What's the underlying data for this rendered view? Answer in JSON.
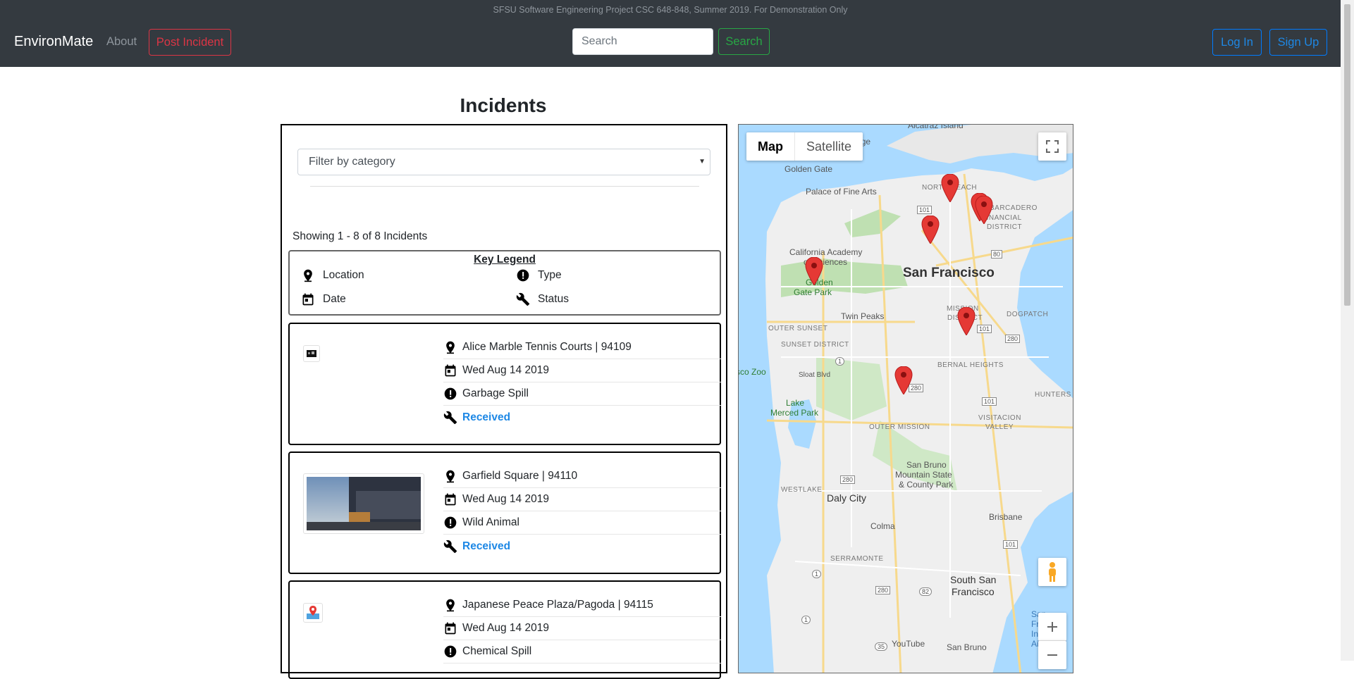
{
  "navbar": {
    "banner": "SFSU Software Engineering Project CSC 648-848, Summer 2019. For Demonstration Only",
    "brand": "EnvironMate",
    "about": "About",
    "post_incident": "Post Incident",
    "search_placeholder": "Search",
    "search_button": "Search",
    "login": "Log In",
    "signup": "Sign Up"
  },
  "page": {
    "title": "Incidents",
    "filter_placeholder": "Filter by category",
    "showing_text": "Showing 1 - 8 of 8 Incidents"
  },
  "legend": {
    "title": "Key Legend",
    "location": "Location",
    "type": "Type",
    "date": "Date",
    "status": "Status"
  },
  "incidents": [
    {
      "location": "Alice Marble Tennis Courts | 94109",
      "date": "Wed Aug 14 2019",
      "type": "Garbage Spill",
      "status": "Received"
    },
    {
      "location": "Garfield Square | 94110",
      "date": "Wed Aug 14 2019",
      "type": "Wild Animal",
      "status": "Received"
    },
    {
      "location": "Japanese Peace Plaza/Pagoda | 94115",
      "date": "Wed Aug 14 2019",
      "type": "Chemical Spill",
      "status": ""
    }
  ],
  "map": {
    "tab_map": "Map",
    "tab_satellite": "Satellite",
    "labels": {
      "alcatraz": "Alcatraz Island",
      "golden_gate_bridge": "Gate Bridge",
      "golden_gate": "Golden Gate",
      "palace": "Palace of Fine Arts",
      "north_beach": "NORTH BEACH",
      "embarcadero": "EMBARCADERO",
      "financial": "FINANCIAL",
      "district": "DISTRICT",
      "cal_academy_1": "California Academy",
      "cal_academy_2": "of Sciences",
      "san_francisco": "San Francisco",
      "golden_gate_park_1": "Golden",
      "golden_gate_park_2": "Gate Park",
      "outer_sunset": "OUTER SUNSET",
      "twin_peaks": "Twin Peaks",
      "mission": "MISSION",
      "mission_district": "DISTRICT",
      "dogpatch": "DOGPATCH",
      "sunset_district": "SUNSET DISTRICT",
      "zoo": "sco Zoo",
      "sloat": "Sloat Blvd",
      "bernal": "BERNAL HEIGHTS",
      "hunters": "HUNTERS POI",
      "lake_merced_1": "Lake",
      "lake_merced_2": "Merced Park",
      "outer_mission": "OUTER MISSION",
      "visitacion_1": "VISITACION",
      "visitacion_2": "VALLEY",
      "san_bruno_mtn_1": "San Bruno",
      "san_bruno_mtn_2": "Mountain State",
      "san_bruno_mtn_3": "& County Park",
      "westlake": "WESTLAKE",
      "daly_city": "Daly City",
      "colma": "Colma",
      "brisbane": "Brisbane",
      "serramonte": "SERRAMONTE",
      "south_sf_1": "South San",
      "south_sf_2": "Francisco",
      "youtube": "YouTube",
      "san_bruno": "San Bruno",
      "sf_intl_1": "San",
      "sf_intl_2": "Franc",
      "sf_intl_3": "Intern",
      "sf_intl_4": "Airp"
    },
    "highway_labels": [
      "101",
      "80",
      "101",
      "280",
      "1",
      "280",
      "101",
      "280",
      "101",
      "280",
      "82",
      "1",
      "1",
      "35"
    ]
  },
  "colors": {
    "navbar_bg": "#343a40",
    "danger": "#dc3545",
    "success": "#28a745",
    "primary": "#007bff",
    "status_blue": "#1e88e5",
    "pin_red": "#e53935"
  }
}
